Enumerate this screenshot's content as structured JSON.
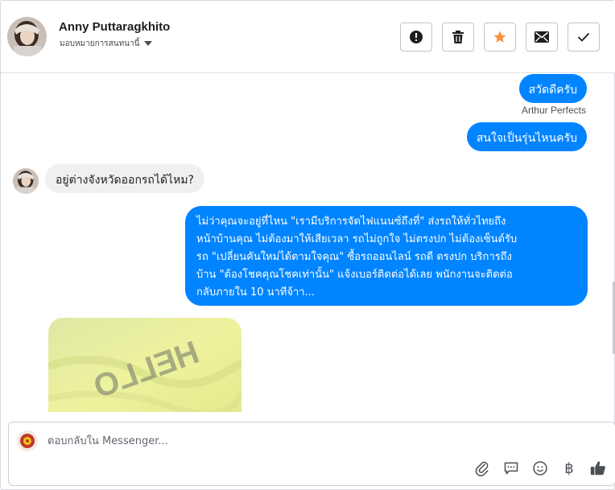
{
  "contact": {
    "name": "Anny Puttaragkhito",
    "assign_label": "มอบหมายการสนทนานี้"
  },
  "actions": [
    {
      "name": "report",
      "icon": "exclamation-circle-icon"
    },
    {
      "name": "delete",
      "icon": "trash-icon"
    },
    {
      "name": "star",
      "icon": "star-icon",
      "color": "#f7923b"
    },
    {
      "name": "mail",
      "icon": "envelope-icon"
    },
    {
      "name": "done",
      "icon": "checkmark-icon"
    }
  ],
  "messages": {
    "out_1": "สวัดดีครับ",
    "sender": "Arthur Perfects",
    "out_2": "สนใจเป็นรุ่นไหนครับ",
    "in_1": "อยู่ต่างจังหวัดออกรถได้ไหม?",
    "out_3_lines": [
      "ไม่ว่าคุณจะอยู่ที่ไหน \"เรามีบริการจัดไฟแนนซ์ถึงที่\"  ส่งรถให้ทั่วไทยถึง",
      "หน้าบ้านคุณ ไม่ต้องมาให้เสียเวลา รถไม่ถูกใจ ไม่ตรงปก ไม่ต้องเซ็นต์รับ",
      "รถ \"เปลี่ยนคันใหม่ได้ตามใจคุณ\" ซื้อรถออนไลน์ รถดี ตรงปก บริการถึง",
      "บ้าน \"ต้องโชคคุณโชคเท่านั้น\" แจ้งเบอร์ติดต่อได้เลย พนักงานจะติดต่อ",
      "กลับภายใน 10 นาทีจ้าา..."
    ],
    "photo_text": "HELLO"
  },
  "composer": {
    "placeholder": "ตอบกลับใน Messenger...",
    "currency_symbol": "฿"
  },
  "colors": {
    "accent": "#0084ff",
    "incoming_bubble": "#f1f0f0",
    "star": "#f7923b"
  }
}
